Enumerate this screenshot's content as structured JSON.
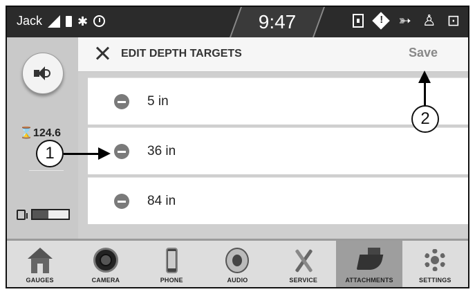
{
  "status_bar": {
    "profile": "Jack",
    "time": "9:47"
  },
  "left_panel": {
    "hours": "⌛124.6",
    "fuel_level": 0.45
  },
  "header": {
    "title": "EDIT DEPTH TARGETS",
    "save_label": "Save"
  },
  "depth_targets": [
    {
      "label": "5 in"
    },
    {
      "label": "36 in"
    },
    {
      "label": "84 in"
    }
  ],
  "callouts": {
    "one": "1",
    "two": "2"
  },
  "bottom_nav": [
    {
      "label": "GAUGES",
      "icon": "home-icon"
    },
    {
      "label": "CAMERA",
      "icon": "camera-icon"
    },
    {
      "label": "PHONE",
      "icon": "phone-icon"
    },
    {
      "label": "AUDIO",
      "icon": "speaker-icon"
    },
    {
      "label": "SERVICE",
      "icon": "wrench-icon"
    },
    {
      "label": "ATTACHMENTS",
      "icon": "bucket-icon",
      "active": true
    },
    {
      "label": "SETTINGS",
      "icon": "gear-icon"
    }
  ]
}
